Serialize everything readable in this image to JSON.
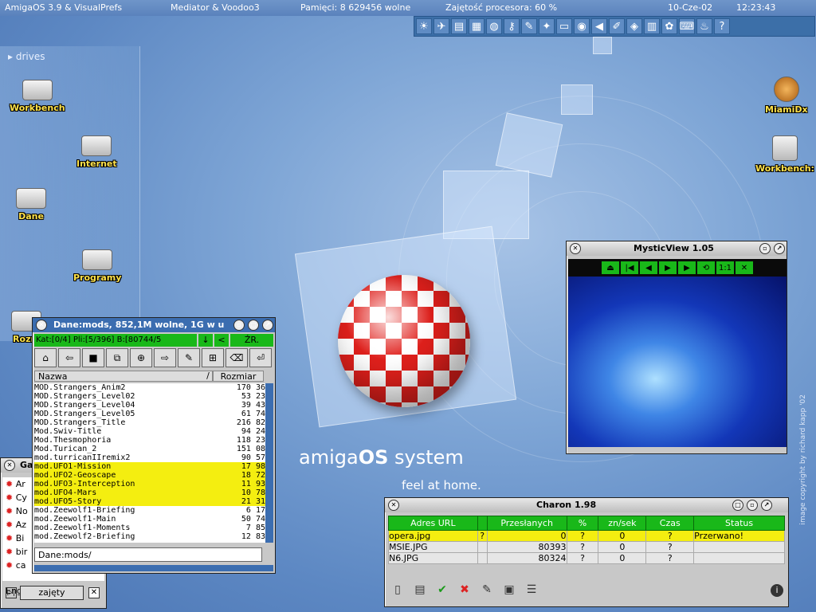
{
  "menubar": {
    "title": "AmigaOS 3.9 & VisualPrefs",
    "gfx": "Mediator & Voodoo3",
    "memory": "Pamięci: 8 629456 wolne",
    "cpu": "Zajętość procesora: 60 %",
    "date": "10-Cze-02",
    "time": "12:23:43"
  },
  "dock": {
    "icons": [
      "sun-icon",
      "joystick-icon",
      "floppy-icon",
      "film-icon",
      "globe-icon",
      "key-icon",
      "tool-icon",
      "paint-icon",
      "monitor-icon",
      "camera-icon",
      "speaker-icon",
      "brush-icon",
      "box-icon",
      "film-strip-icon",
      "dog-icon",
      "keyboard-icon",
      "fire-icon",
      "help-icon"
    ],
    "glyphs": [
      "☀",
      "✈",
      "▤",
      "▦",
      "◍",
      "⚷",
      "✎",
      "✦",
      "▭",
      "◉",
      "◀",
      "✐",
      "◈",
      "▥",
      "✿",
      "⌨",
      "♨",
      "?"
    ]
  },
  "drives": {
    "header": "drives",
    "items": [
      {
        "label": "Workbench"
      },
      {
        "label": "Internet"
      },
      {
        "label": "Dane"
      },
      {
        "label": "Programy"
      },
      {
        "label": "Rozm"
      }
    ]
  },
  "right_icons": [
    {
      "label": "MiamiDx"
    },
    {
      "label": "Workbench:"
    }
  ],
  "brand": {
    "amiga": "amiga",
    "os": "OS",
    "system": " system",
    "tagline": "feel at home."
  },
  "copyright": "image copyright by richard kapp '02",
  "dopus": {
    "title": "Dane:mods,  852,1M wolne, 1G w u",
    "status": "Kat:[0/4] Pli:[5/396] B:[80744/5",
    "btn_down": "↓",
    "btn_left": "<",
    "btn_src": "ŹR.",
    "col_name": "Nazwa",
    "col_sort": "/",
    "col_size": "Rozmiar",
    "path": "Dane:mods/",
    "rows": [
      {
        "name": "MOD.Strangers_Anim2",
        "size": "170 36",
        "sel": false
      },
      {
        "name": "MOD.Strangers_Level02",
        "size": "53 23",
        "sel": false
      },
      {
        "name": "MOD.Strangers_Level04",
        "size": "39 43",
        "sel": false
      },
      {
        "name": "MOD.Strangers_Level05",
        "size": "61 74",
        "sel": false
      },
      {
        "name": "MOD.Strangers_Title",
        "size": "216 82",
        "sel": false
      },
      {
        "name": "Mod.Swiv-Title",
        "size": "94 24",
        "sel": false
      },
      {
        "name": "Mod.Thesmophoria",
        "size": "118 23",
        "sel": false
      },
      {
        "name": "Mod.Turican_2",
        "size": "151 08",
        "sel": false
      },
      {
        "name": "mod.turricanIIremix2",
        "size": "90 57",
        "sel": false
      },
      {
        "name": "mod.UFO1-Mission",
        "size": "17 98",
        "sel": true
      },
      {
        "name": "mod.UFO2-Geoscape",
        "size": "18 72",
        "sel": true
      },
      {
        "name": "mod.UFO3-Interception",
        "size": "11 93",
        "sel": true
      },
      {
        "name": "mod.UFO4-Mars",
        "size": "10 78",
        "sel": true
      },
      {
        "name": "mod.UFO5-Story",
        "size": "21 31",
        "sel": true
      },
      {
        "name": "mod.Zeewolf1-Briefing",
        "size": "6 17",
        "sel": false
      },
      {
        "name": "mod.Zeewolf1-Main",
        "size": "50 74",
        "sel": false
      },
      {
        "name": "mod.Zeewolf1-Moments",
        "size": "7 85",
        "sel": false
      },
      {
        "name": "mod.Zeewolf2-Briefing",
        "size": "12 83",
        "sel": false
      }
    ]
  },
  "games": {
    "title": "Ga",
    "items": [
      "Ar",
      "Cy",
      "No",
      "Az",
      "Bi",
      "bir",
      "ca"
    ],
    "last": "Engine",
    "status": "zajęty"
  },
  "mystic": {
    "title": "MysticView 1.05",
    "controls": [
      "⏏",
      "|◀",
      "◀",
      "▶",
      "▶",
      "⟲",
      "1:1",
      "✕"
    ]
  },
  "charon": {
    "title": "Charon 1.98",
    "headers": [
      "Adres URL",
      "",
      "Przesłanych",
      "%",
      "zn/sek",
      "Czas",
      "Status"
    ],
    "rows": [
      {
        "url": "opera.jpg",
        "flag": "?",
        "sent": "0",
        "pct": "?",
        "rate": "0",
        "time": "?",
        "status": "Przerwano!",
        "hl": true
      },
      {
        "url": "MSIE.JPG",
        "flag": "",
        "sent": "80393",
        "pct": "?",
        "rate": "0",
        "time": "?",
        "status": "",
        "hl": false
      },
      {
        "url": "N6.JPG",
        "flag": "",
        "sent": "80324",
        "pct": "?",
        "rate": "0",
        "time": "?",
        "status": "",
        "hl": false
      }
    ],
    "tools": [
      "new-icon",
      "folder-icon",
      "ok-icon",
      "cancel-icon",
      "edit-icon",
      "trash-icon",
      "log-icon"
    ],
    "tool_glyphs": [
      "▯",
      "▤",
      "✔",
      "✖",
      "✎",
      "▣",
      "☰"
    ]
  }
}
